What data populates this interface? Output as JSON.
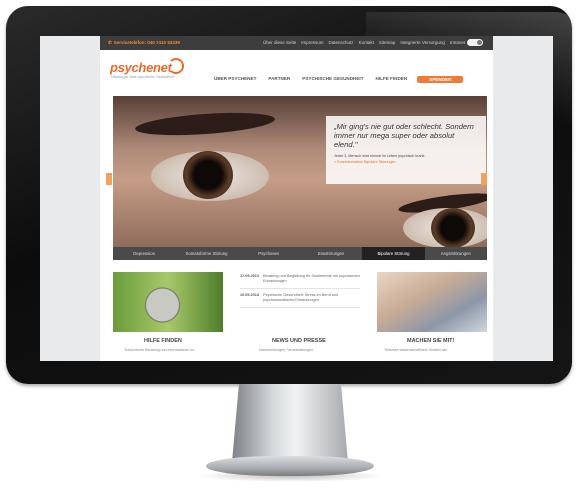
{
  "site": {
    "topbar": {
      "service_label": "Servicetelefon: 040 7410 53339",
      "links": [
        "Über diese Seite",
        "Impressum",
        "Datenschutz",
        "Kontakt",
        "Sitemap",
        "Integrierte Versorgung",
        "Intranet"
      ]
    },
    "logo": {
      "text": "psychenet",
      "tagline": "Hamburger Netz psychische Gesundheit"
    },
    "nav": {
      "items": [
        "ÜBER PSYCHENET",
        "PARTNER",
        "PSYCHISCHE GESUNDHEIT",
        "HILFE FINDEN"
      ],
      "cta": "SPENDEN"
    },
    "hero": {
      "quote": "„Mir ging's nie gut oder schlecht. Sondern immer nur mega super oder absolut elend.\"",
      "subtext": "Jeder 3. Mensch wird einmal im Leben psychisch krank.",
      "link": "> Kurzinformation Bipolare Störungen"
    },
    "tabs": [
      {
        "label": "Depression",
        "active": false
      },
      {
        "label": "Somatoforme Störung",
        "active": false
      },
      {
        "label": "Psychosen",
        "active": false
      },
      {
        "label": "Essstörungen",
        "active": false
      },
      {
        "label": "Bipolare Störung",
        "active": true
      },
      {
        "label": "Angststörungen",
        "active": false
      }
    ],
    "cards": {
      "left": {
        "title": "HILFE FINDEN",
        "text": "Telefonische Beratung und Informationen zu"
      },
      "middle": {
        "title": "NEWS UND PRESSE",
        "text": "Nachmeldungen, Veranstaltungen,"
      },
      "right": {
        "title": "MACHEN SIE MIT!",
        "text": "Teilweise wissenschaftliche Studien wie"
      }
    },
    "news": [
      {
        "date": "17.09.2013",
        "text": "Beratung und Begleitung für Studierende mit psychischen Erkrankungen"
      },
      {
        "date": "10.09.2013",
        "text": "Psychische Gesundheit: Stress im Beruf und psychosomatische Erkrankungen"
      }
    ]
  },
  "colors": {
    "accent": "#ea6b2a",
    "topbar": "#3d3d3d",
    "tabs": "#4a4a4a"
  },
  "icons": {
    "phone": "phone-icon"
  }
}
